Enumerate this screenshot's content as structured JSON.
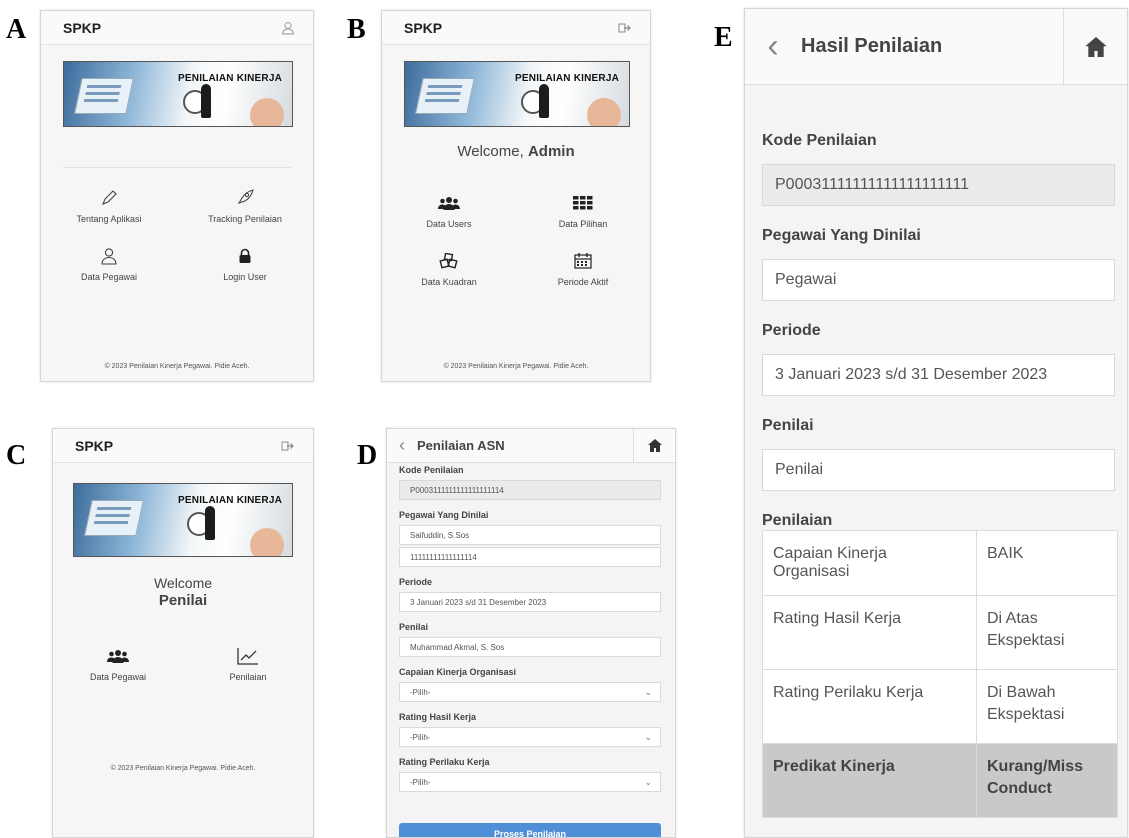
{
  "labels": {
    "a": "A",
    "b": "B",
    "c": "C",
    "d": "D",
    "e": "E"
  },
  "app": {
    "brand": "SPKP",
    "banner_text": "PENILAIAN KINERJA",
    "footer": "© 2023 Penilaian Kinerja Pegawai. Pidie Aceh."
  },
  "panel_a": {
    "tiles": [
      {
        "icon": "pencil-icon",
        "label": "Tentang Aplikasi"
      },
      {
        "icon": "rocket-icon",
        "label": "Tracking Penilaian"
      },
      {
        "icon": "user-icon",
        "label": "Data Pegawai"
      },
      {
        "icon": "lock-icon",
        "label": "Login User"
      }
    ]
  },
  "panel_b": {
    "welcome_prefix": "Welcome,",
    "welcome_name": "Admin",
    "tiles": [
      {
        "icon": "users-icon",
        "label": "Data Users"
      },
      {
        "icon": "grid-icon",
        "label": "Data Pilihan"
      },
      {
        "icon": "cubes-icon",
        "label": "Data Kuadran"
      },
      {
        "icon": "calendar-icon",
        "label": "Periode Aktif"
      }
    ]
  },
  "panel_c": {
    "welcome_prefix": "Welcome",
    "welcome_name": "Penilai",
    "tiles": [
      {
        "icon": "users-icon",
        "label": "Data Pegawai"
      },
      {
        "icon": "chart-line-icon",
        "label": "Penilaian"
      }
    ]
  },
  "panel_d": {
    "title": "Penilaian ASN",
    "kode_label": "Kode Penilaian",
    "kode_value": "P0003111111111111111114",
    "pegawai_label": "Pegawai Yang Dinilai",
    "pegawai_name": "Saifuddin, S.Sos",
    "pegawai_nip": "11111111111111114",
    "periode_label": "Periode",
    "periode_value": "3 Januari 2023 s/d 31 Desember 2023",
    "penilai_label": "Penilai",
    "penilai_value": "Muhammad Akmal, S. Sos",
    "capaian_label": "Capaian Kinerja Organisasi",
    "rating_hasil_label": "Rating Hasil Kerja",
    "rating_perilaku_label": "Rating Perilaku Kerja",
    "select_placeholder": "-Pilih-",
    "submit_label": "Proses Penilaian"
  },
  "panel_e": {
    "title": "Hasil Penilaian",
    "kode_label": "Kode Penilaian",
    "kode_value": "P00031111111111111111111",
    "pegawai_label": "Pegawai Yang Dinilai",
    "pegawai_value": "Pegawai",
    "periode_label": "Periode",
    "periode_value": "3 Januari 2023 s/d 31 Desember 2023",
    "penilai_label": "Penilai",
    "penilai_value": "Penilai",
    "penilaian_label": "Penilaian",
    "rows": [
      {
        "name": "Capaian Kinerja Organisasi",
        "value": "BAIK"
      },
      {
        "name": "Rating Hasil Kerja",
        "value": "Di Atas Ekspektasi"
      },
      {
        "name": "Rating Perilaku Kerja",
        "value": "Di Bawah Ekspektasi"
      },
      {
        "name": "Predikat Kinerja",
        "value": "Kurang/Miss Conduct"
      }
    ]
  },
  "colors": {
    "primary_button": "#4f8fd8",
    "predikat_row": "#c9c9c9"
  }
}
